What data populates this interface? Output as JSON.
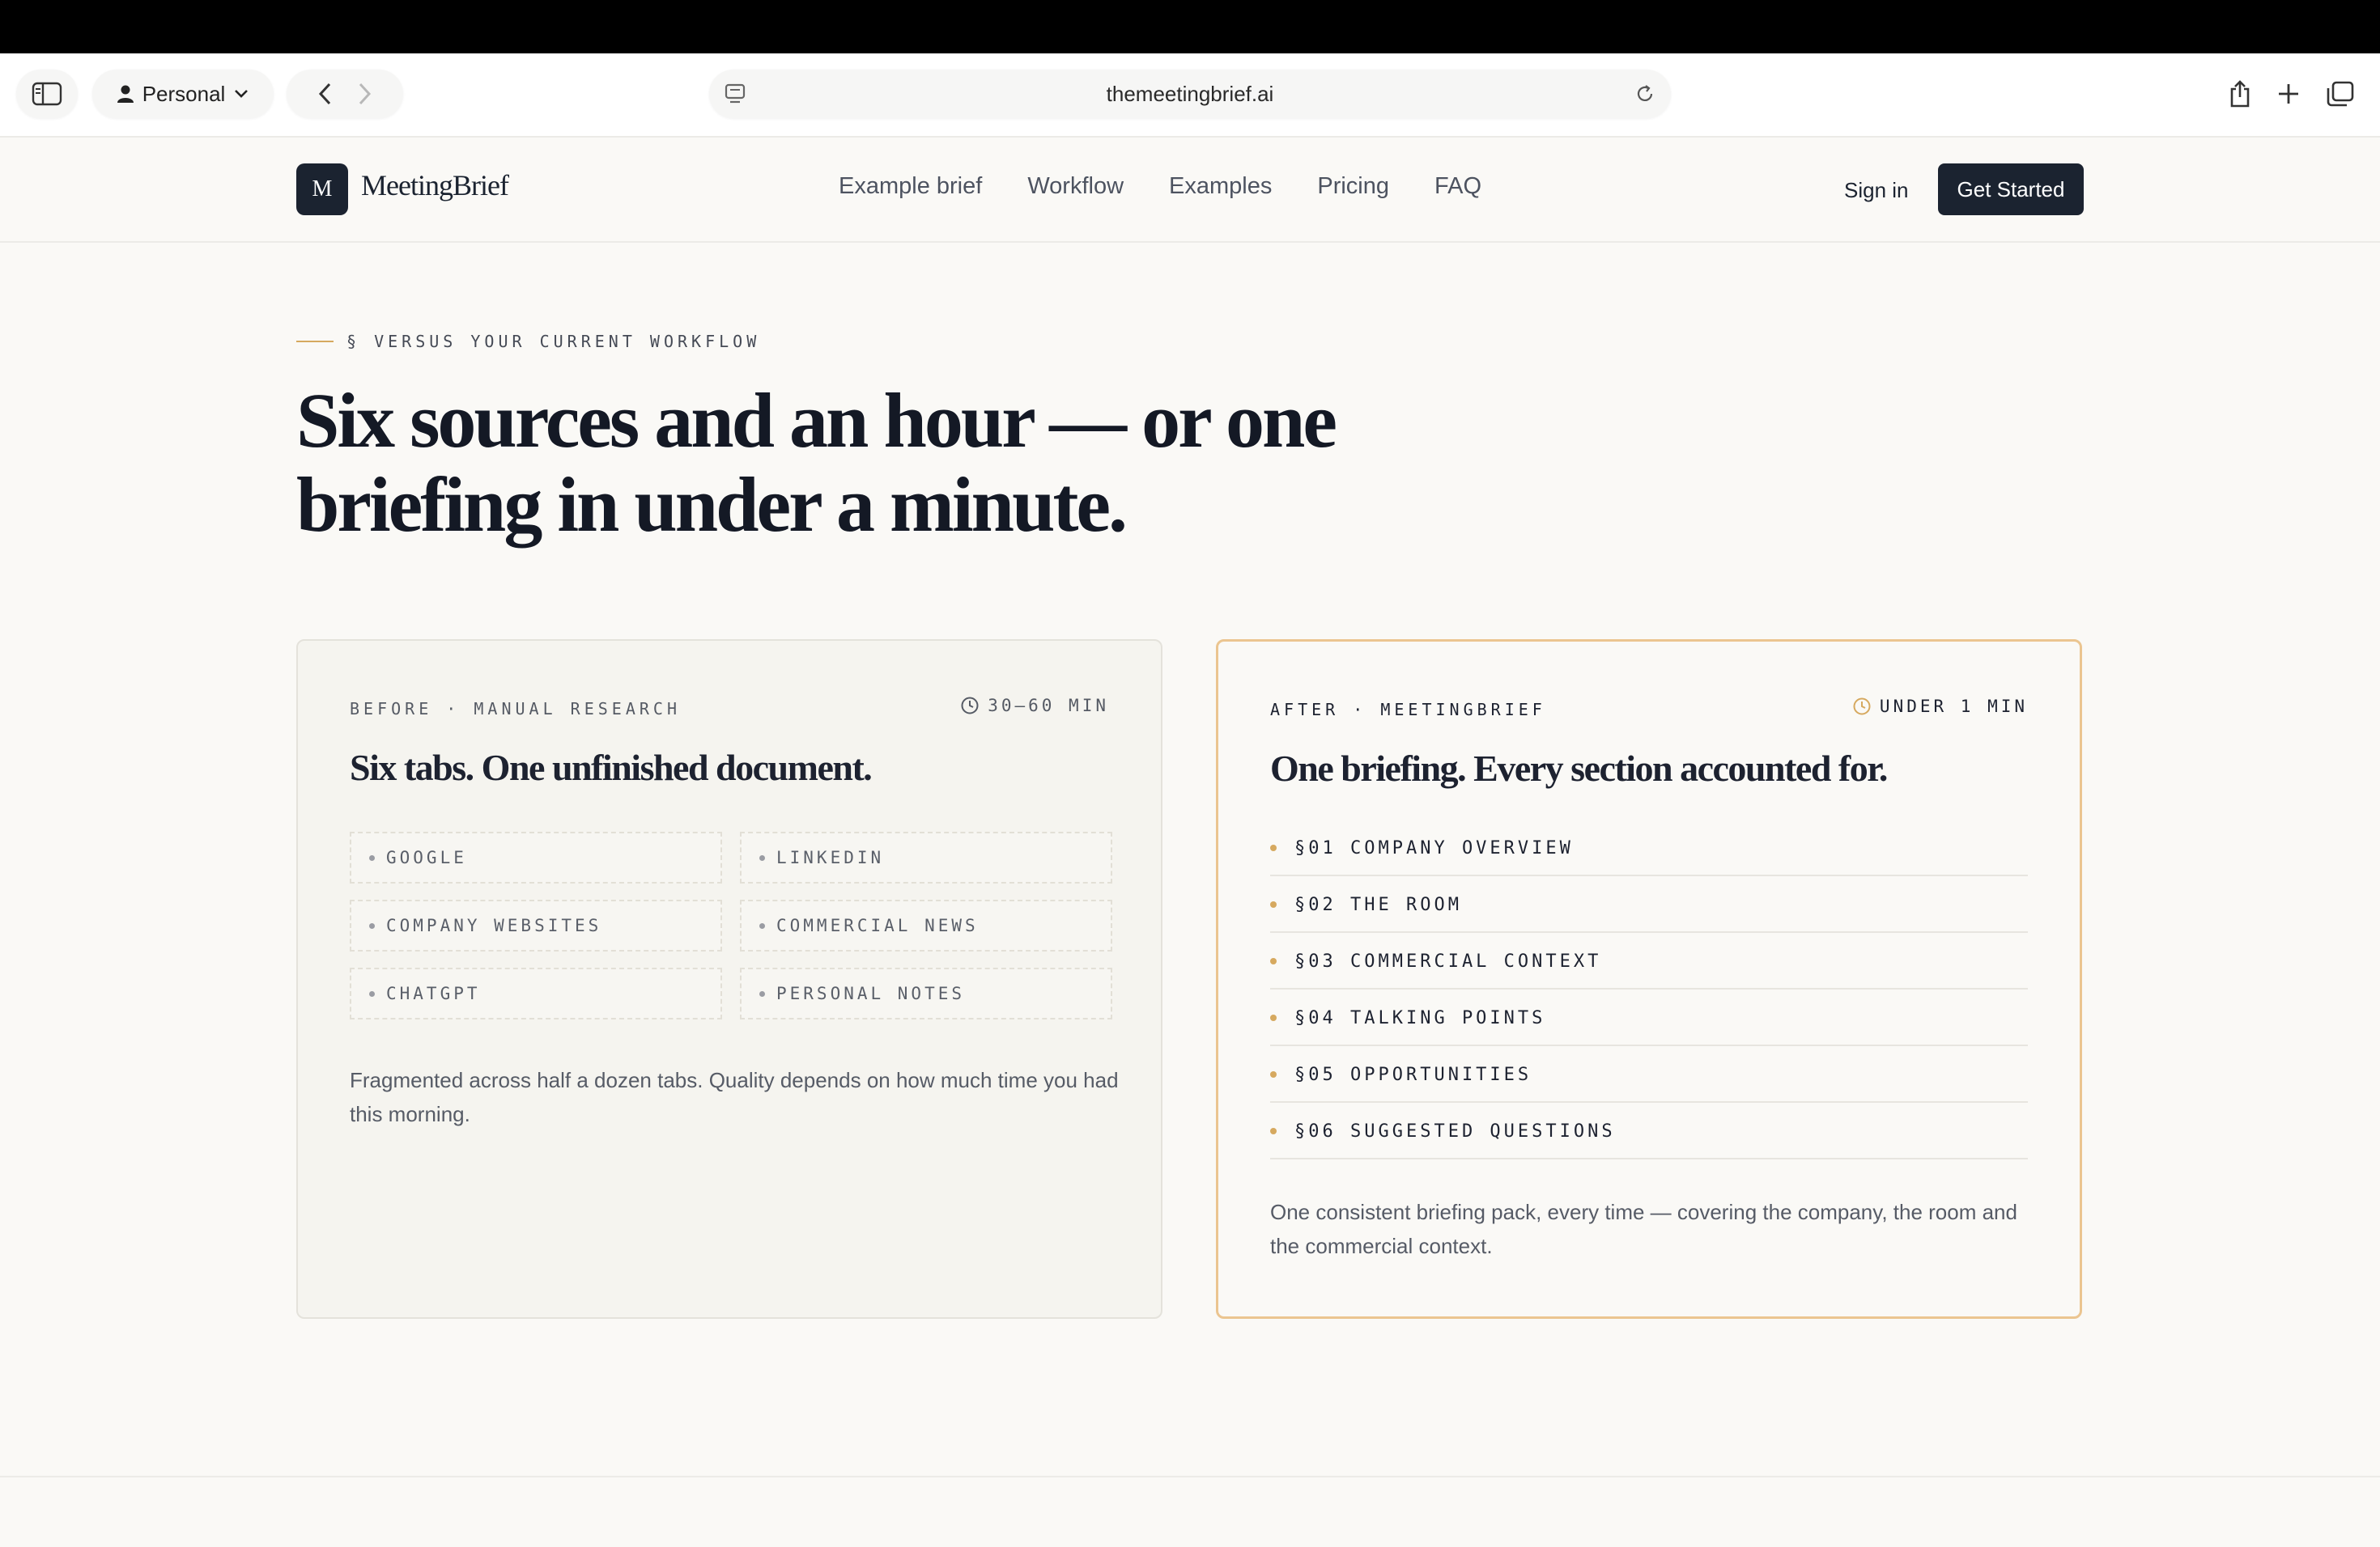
{
  "browser": {
    "profile_label": "Personal",
    "url": "themeetingbrief.ai"
  },
  "header": {
    "logo_mark": "M",
    "logo_text": "MeetingBrief",
    "nav": [
      "Example brief",
      "Workflow",
      "Examples",
      "Pricing",
      "FAQ"
    ],
    "signin_label": "Sign in",
    "cta_label": "Get Started"
  },
  "hero": {
    "eyebrow": "§ VERSUS YOUR CURRENT WORKFLOW",
    "headline_line1": "Six sources and an hour — or one",
    "headline_line2": "briefing in under a minute."
  },
  "before": {
    "label": "BEFORE · MANUAL RESEARCH",
    "time": "30–60 MIN",
    "title": "Six tabs. One unfinished document.",
    "sources": [
      "GOOGLE",
      "LINKEDIN",
      "COMPANY WEBSITES",
      "COMMERCIAL NEWS",
      "CHATGPT",
      "PERSONAL NOTES"
    ],
    "description": "Fragmented across half a dozen tabs. Quality depends on how much time you had this morning."
  },
  "after": {
    "label": "AFTER · MEETINGBRIEF",
    "time": "UNDER 1 MIN",
    "title": "One briefing. Every section accounted for.",
    "sections": [
      "§01 COMPANY OVERVIEW",
      "§02 THE ROOM",
      "§03 COMMERCIAL CONTEXT",
      "§04 TALKING POINTS",
      "§05 OPPORTUNITIES",
      "§06 SUGGESTED QUESTIONS"
    ],
    "description": "One consistent briefing pack, every time — covering the company, the room and the commercial context."
  },
  "colors": {
    "brand_dark": "#1b2330",
    "accent_gold": "#d6a95f",
    "after_border": "#ebc590",
    "page_bg": "#faf9f6"
  },
  "icons": [
    "sidebar-icon",
    "person-icon",
    "chevron-down-icon",
    "back-icon",
    "forward-icon",
    "tab-icon",
    "reload-icon",
    "share-icon",
    "plus-icon",
    "tabs-overview-icon",
    "clock-icon"
  ]
}
